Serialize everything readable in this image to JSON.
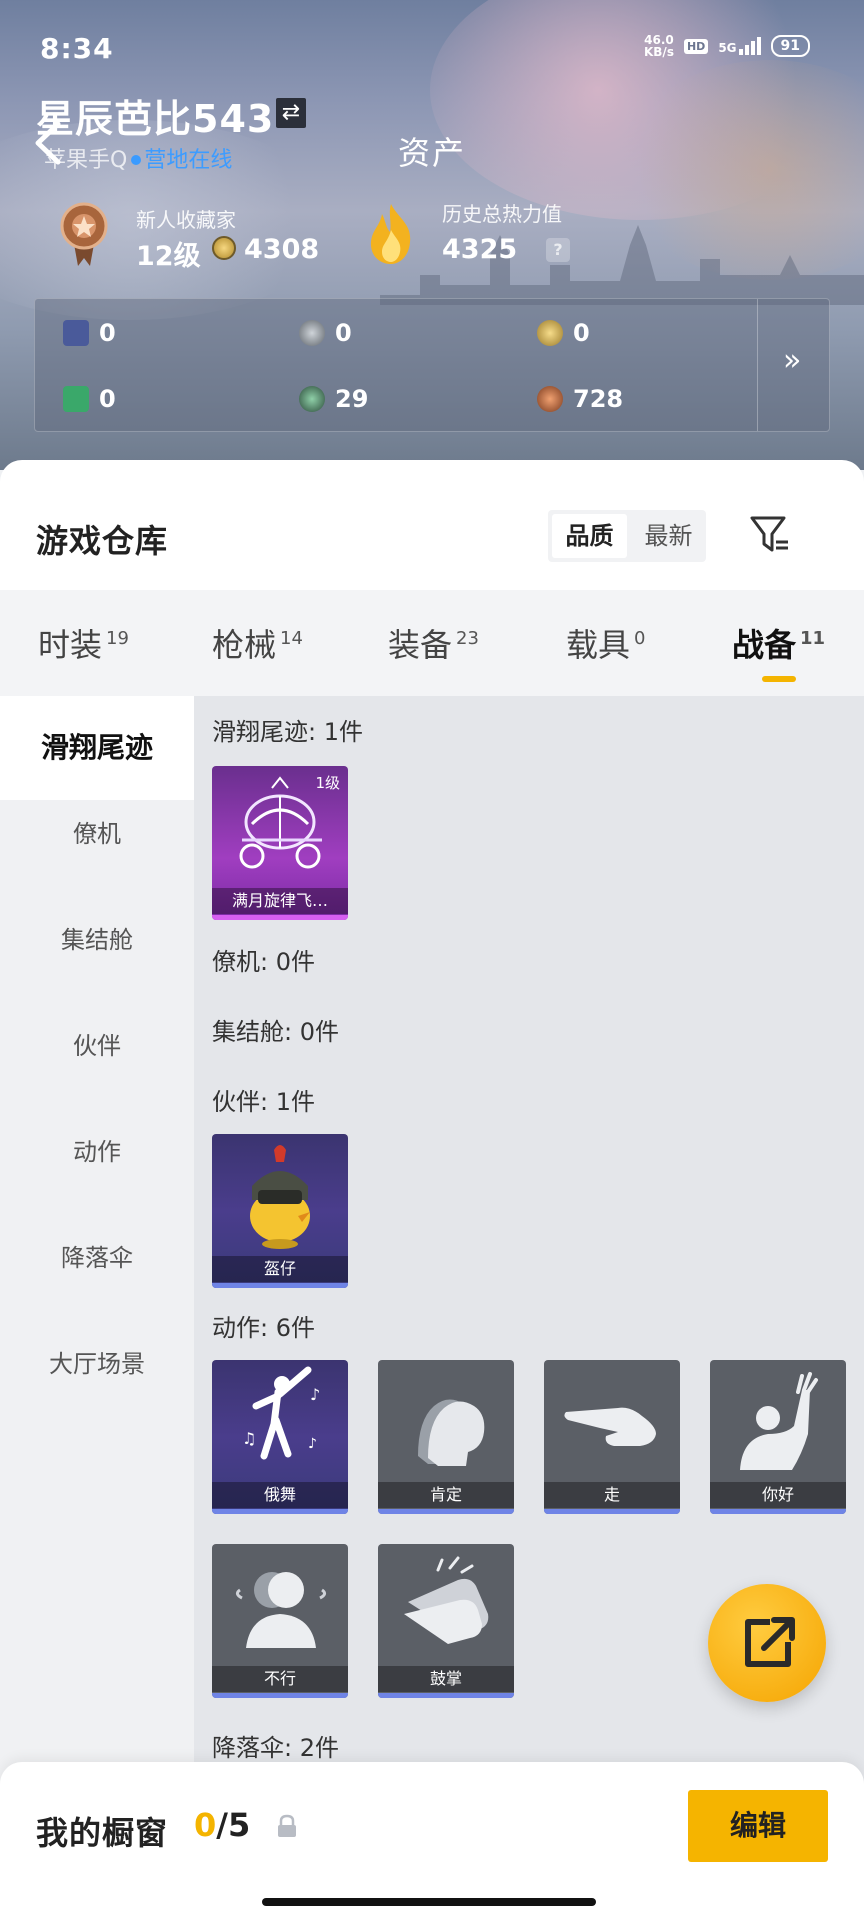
{
  "status_bar": {
    "time": "8:34",
    "net_speed_value": "46.0",
    "net_speed_unit": "KB/s",
    "hd": "HD",
    "network": "5G",
    "battery": "91"
  },
  "header": {
    "player_name": "星辰芭比543",
    "account_prefix": "苹果手Q",
    "online_status": "营地在线",
    "page_title": "资产",
    "collector_label": "新人收藏家",
    "collector_level": "12级",
    "coin_value": "4308",
    "heat_label": "历史总热力值",
    "heat_value": "4325",
    "help": "?"
  },
  "currencies": [
    {
      "name": "card-currency",
      "value": "0",
      "color": "#5c6aa8"
    },
    {
      "name": "silver-coin",
      "value": "0",
      "color": "#8a9097"
    },
    {
      "name": "gold-coin",
      "value": "0",
      "color": "#c8a24a"
    },
    {
      "name": "green-ticket",
      "value": "0",
      "color": "#3aa86a"
    },
    {
      "name": "green-orb",
      "value": "29",
      "color": "#3c6b52"
    },
    {
      "name": "bronze-coin",
      "value": "728",
      "color": "#b8643a"
    }
  ],
  "warehouse": {
    "title": "游戏仓库",
    "sort_quality": "品质",
    "sort_latest": "最新"
  },
  "tabs": [
    {
      "label": "时装",
      "count": "19"
    },
    {
      "label": "枪械",
      "count": "14"
    },
    {
      "label": "装备",
      "count": "23"
    },
    {
      "label": "载具",
      "count": "0"
    },
    {
      "label": "战备",
      "count": "11"
    }
  ],
  "side_nav": [
    "滑翔尾迹",
    "僚机",
    "集结舱",
    "伙伴",
    "动作",
    "降落伞",
    "大厅场景"
  ],
  "categories": {
    "glide": "滑翔尾迹: 1件",
    "wingman": "僚机: 0件",
    "assembly": "集结舱: 0件",
    "partner": "伙伴: 1件",
    "action": "动作: 6件",
    "parachute": "降落伞: 2件"
  },
  "items": {
    "glide_trail": {
      "name": "满月旋律飞…",
      "level": "1级"
    },
    "partner": {
      "name": "盔仔"
    },
    "actions": [
      "俄舞",
      "肯定",
      "走",
      "你好",
      "不行",
      "鼓掌"
    ]
  },
  "showcase": {
    "title": "我的橱窗",
    "current": "0",
    "sep_total": "/5",
    "edit_label": "编辑"
  },
  "colors": {
    "accent": "#f4b400",
    "online": "#3d9cff"
  }
}
